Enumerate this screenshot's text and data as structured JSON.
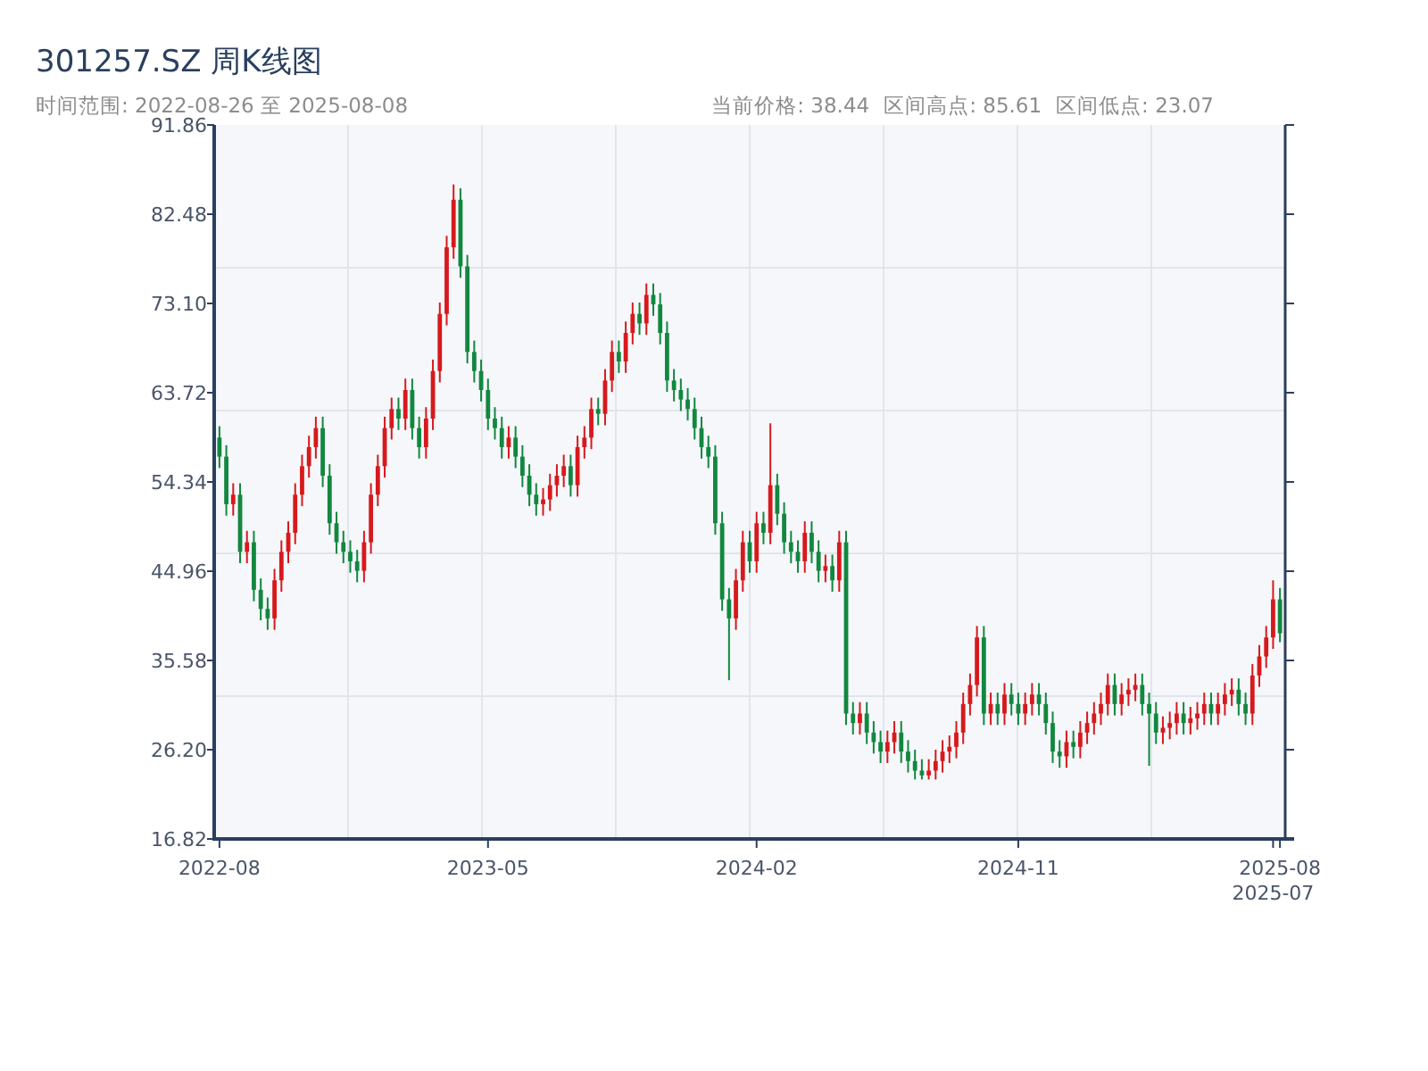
{
  "title": "301257.SZ 周K线图",
  "subtitle": "时间范围: 2022-08-26 至 2025-08-08",
  "stats": [
    "当前价格: 38.44",
    "区间高点: 85.61",
    "区间低点: 23.07"
  ],
  "chart": {
    "chart_data": {
      "type": "candlestick",
      "ylim": [
        16.82,
        91.86
      ],
      "yticks": [
        {
          "value": 91.86,
          "label": "91.86"
        },
        {
          "value": 82.48,
          "label": "82.48"
        },
        {
          "value": 73.1,
          "label": "73.10"
        },
        {
          "value": 63.72,
          "label": "63.72"
        },
        {
          "value": 54.34,
          "label": "54.34"
        },
        {
          "value": 44.96,
          "label": "44.96"
        },
        {
          "value": 35.58,
          "label": "35.58"
        },
        {
          "value": 26.2,
          "label": "26.20"
        },
        {
          "value": 16.82,
          "label": "16.82"
        }
      ],
      "categories": [
        "2022-08",
        null,
        null,
        null,
        null,
        null,
        null,
        null,
        null,
        null,
        null,
        null,
        null,
        null,
        null,
        null,
        null,
        null,
        null,
        null,
        null,
        null,
        null,
        null,
        null,
        null,
        null,
        null,
        null,
        null,
        null,
        null,
        null,
        null,
        null,
        null,
        null,
        null,
        null,
        "2023-05",
        null,
        null,
        null,
        null,
        null,
        null,
        null,
        null,
        null,
        null,
        null,
        null,
        null,
        null,
        null,
        null,
        null,
        null,
        null,
        null,
        null,
        null,
        null,
        null,
        null,
        null,
        null,
        null,
        null,
        null,
        null,
        null,
        null,
        null,
        null,
        null,
        null,
        null,
        "2024-02",
        null,
        null,
        null,
        null,
        null,
        null,
        null,
        null,
        null,
        null,
        null,
        null,
        null,
        null,
        null,
        null,
        null,
        null,
        null,
        null,
        null,
        null,
        null,
        null,
        null,
        null,
        null,
        null,
        null,
        null,
        null,
        null,
        null,
        null,
        null,
        null,
        null,
        "2024-11",
        null,
        null,
        null,
        null,
        null,
        null,
        null,
        null,
        null,
        null,
        null,
        null,
        null,
        null,
        null,
        null,
        null,
        null,
        null,
        null,
        null,
        null,
        null,
        null,
        null,
        null,
        null,
        null,
        null,
        null,
        null,
        null,
        null,
        null,
        null,
        null,
        "2025-07",
        "2025-08"
      ],
      "ohlc": [
        [
          59,
          60.2,
          55.8,
          57
        ],
        [
          57,
          58.2,
          50.8,
          52
        ],
        [
          52,
          54.2,
          50.8,
          53
        ],
        [
          53,
          54.2,
          45.8,
          47
        ],
        [
          47,
          49.2,
          45.8,
          48
        ],
        [
          48,
          49.2,
          41.8,
          43
        ],
        [
          43,
          44.2,
          39.8,
          41
        ],
        [
          41,
          42.2,
          38.8,
          40
        ],
        [
          40,
          45.2,
          38.8,
          44
        ],
        [
          44,
          48.2,
          42.8,
          47
        ],
        [
          47,
          50.2,
          45.8,
          49
        ],
        [
          49,
          54.2,
          47.8,
          53
        ],
        [
          53,
          57.2,
          51.8,
          56
        ],
        [
          56,
          59.2,
          54.8,
          58
        ],
        [
          58,
          61.2,
          56.8,
          60
        ],
        [
          60,
          61.2,
          53.8,
          55
        ],
        [
          55,
          56.2,
          48.8,
          50
        ],
        [
          50,
          51.2,
          46.8,
          48
        ],
        [
          48,
          49.2,
          45.8,
          47
        ],
        [
          47,
          48.2,
          44.8,
          46
        ],
        [
          46,
          47.2,
          43.8,
          45
        ],
        [
          45,
          49.2,
          43.8,
          48
        ],
        [
          48,
          54.2,
          46.8,
          53
        ],
        [
          53,
          57.2,
          51.8,
          56
        ],
        [
          56,
          61.2,
          54.8,
          60
        ],
        [
          60,
          63.2,
          58.8,
          62
        ],
        [
          62,
          63.2,
          59.8,
          61
        ],
        [
          61,
          65.2,
          59.8,
          64
        ],
        [
          64,
          65.2,
          58.8,
          60
        ],
        [
          60,
          61.2,
          56.8,
          58
        ],
        [
          58,
          62.2,
          56.8,
          61
        ],
        [
          61,
          67.2,
          59.8,
          66
        ],
        [
          66,
          73.2,
          64.8,
          72
        ],
        [
          72,
          80.2,
          70.8,
          79
        ],
        [
          79,
          85.61,
          77.8,
          84
        ],
        [
          84,
          85.2,
          75.8,
          77
        ],
        [
          77,
          78.2,
          66.8,
          68
        ],
        [
          68,
          69.2,
          64.8,
          66
        ],
        [
          66,
          67.2,
          62.8,
          64
        ],
        [
          64,
          65.2,
          59.8,
          61
        ],
        [
          61,
          62.2,
          58.8,
          60
        ],
        [
          60,
          61.2,
          56.8,
          58
        ],
        [
          58,
          60.2,
          56.8,
          59
        ],
        [
          59,
          60.2,
          55.8,
          57
        ],
        [
          57,
          58.2,
          53.8,
          55
        ],
        [
          55,
          56.2,
          51.8,
          53
        ],
        [
          53,
          54.2,
          50.8,
          52
        ],
        [
          52,
          53.7,
          50.8,
          52.5
        ],
        [
          52.5,
          55.2,
          51.3,
          54
        ],
        [
          54,
          56.2,
          52.8,
          55
        ],
        [
          55,
          57.2,
          53.8,
          56
        ],
        [
          56,
          57.2,
          52.8,
          54
        ],
        [
          54,
          59.2,
          52.8,
          58
        ],
        [
          58,
          60.2,
          56.8,
          59
        ],
        [
          59,
          63.2,
          57.8,
          62
        ],
        [
          62,
          63.2,
          60.3,
          61.5
        ],
        [
          61.5,
          66.2,
          60.3,
          65
        ],
        [
          65,
          69.2,
          63.8,
          68
        ],
        [
          68,
          69.2,
          65.8,
          67
        ],
        [
          67,
          71.2,
          65.8,
          70
        ],
        [
          70,
          73.2,
          68.8,
          72
        ],
        [
          72,
          73.2,
          69.8,
          71
        ],
        [
          71,
          75.2,
          69.8,
          74
        ],
        [
          74,
          75.2,
          71.8,
          73
        ],
        [
          73,
          74.2,
          68.8,
          70
        ],
        [
          70,
          71.2,
          63.8,
          65
        ],
        [
          65,
          66.2,
          62.8,
          64
        ],
        [
          64,
          65.2,
          61.8,
          63
        ],
        [
          63,
          64.2,
          60.8,
          62
        ],
        [
          62,
          63.2,
          58.8,
          60
        ],
        [
          60,
          61.2,
          56.8,
          58
        ],
        [
          58,
          59.2,
          55.8,
          57
        ],
        [
          57,
          58.2,
          48.8,
          50
        ],
        [
          50,
          51.2,
          40.8,
          42
        ],
        [
          42,
          43.2,
          33.5,
          40
        ],
        [
          40,
          45.2,
          38.8,
          44
        ],
        [
          44,
          49.2,
          42.8,
          48
        ],
        [
          48,
          49.2,
          44.8,
          46
        ],
        [
          46,
          51.2,
          44.8,
          50
        ],
        [
          50,
          51.2,
          47.8,
          49
        ],
        [
          49,
          60.5,
          47.8,
          54
        ],
        [
          54,
          55.2,
          49.8,
          51
        ],
        [
          51,
          52.2,
          46.8,
          48
        ],
        [
          48,
          49.2,
          45.8,
          47
        ],
        [
          47,
          48.2,
          44.8,
          46
        ],
        [
          46,
          50.2,
          44.8,
          49
        ],
        [
          49,
          50.2,
          45.8,
          47
        ],
        [
          47,
          48.2,
          43.8,
          45
        ],
        [
          45,
          46.7,
          43.8,
          45.5
        ],
        [
          45.5,
          46.7,
          42.8,
          44
        ],
        [
          44,
          49.2,
          42.8,
          48
        ],
        [
          48,
          49.2,
          28.8,
          30
        ],
        [
          30,
          31.2,
          27.8,
          29
        ],
        [
          29,
          31.2,
          27.8,
          30
        ],
        [
          30,
          31.2,
          26.8,
          28
        ],
        [
          28,
          29.2,
          25.8,
          27
        ],
        [
          27,
          28.2,
          24.8,
          26
        ],
        [
          26,
          28.2,
          24.8,
          27
        ],
        [
          27,
          29.2,
          25.8,
          28
        ],
        [
          28,
          29.2,
          24.8,
          26
        ],
        [
          26,
          27.2,
          23.8,
          25
        ],
        [
          25,
          26.2,
          23.07,
          24
        ],
        [
          24,
          25.2,
          23.07,
          23.5
        ],
        [
          23.5,
          25.2,
          23.07,
          24
        ],
        [
          24,
          26.2,
          23.07,
          25
        ],
        [
          25,
          27.2,
          23.8,
          26
        ],
        [
          26,
          27.7,
          24.8,
          26.5
        ],
        [
          26.5,
          29.2,
          25.3,
          28
        ],
        [
          28,
          32.2,
          26.8,
          31
        ],
        [
          31,
          34.2,
          29.8,
          33
        ],
        [
          33,
          39.2,
          31.8,
          38
        ],
        [
          38,
          39.2,
          28.8,
          30
        ],
        [
          30,
          32.2,
          28.8,
          31
        ],
        [
          31,
          32.2,
          28.8,
          30
        ],
        [
          30,
          33.2,
          28.8,
          32
        ],
        [
          32,
          33.2,
          29.8,
          31
        ],
        [
          31,
          32.2,
          28.8,
          30
        ],
        [
          30,
          32.2,
          28.8,
          31
        ],
        [
          31,
          33.2,
          29.8,
          32
        ],
        [
          32,
          33.2,
          29.8,
          31
        ],
        [
          31,
          32.2,
          27.8,
          29
        ],
        [
          29,
          30.2,
          24.8,
          26
        ],
        [
          26,
          27.2,
          24.3,
          25.5
        ],
        [
          25.5,
          28.2,
          24.3,
          27
        ],
        [
          27,
          28.2,
          25.3,
          26.5
        ],
        [
          26.5,
          29.2,
          25.3,
          28
        ],
        [
          28,
          30.2,
          26.8,
          29
        ],
        [
          29,
          31.2,
          27.8,
          30
        ],
        [
          30,
          32.2,
          28.8,
          31
        ],
        [
          31,
          34.2,
          29.8,
          33
        ],
        [
          33,
          34.2,
          29.8,
          31
        ],
        [
          31,
          33.2,
          29.8,
          32
        ],
        [
          32,
          33.7,
          30.8,
          32.5
        ],
        [
          32.5,
          34.2,
          31.3,
          33
        ],
        [
          33,
          34.2,
          29.8,
          31
        ],
        [
          31,
          32.2,
          24.5,
          30
        ],
        [
          30,
          31.2,
          26.8,
          28
        ],
        [
          28,
          29.7,
          26.8,
          28.5
        ],
        [
          28.5,
          30.2,
          27.3,
          29
        ],
        [
          29,
          31.2,
          27.8,
          30
        ],
        [
          30,
          31.2,
          27.8,
          29
        ],
        [
          29,
          30.7,
          27.8,
          29.5
        ],
        [
          29.5,
          31.2,
          28.3,
          30
        ],
        [
          30,
          32.2,
          28.8,
          31
        ],
        [
          31,
          32.2,
          28.8,
          30
        ],
        [
          30,
          32.2,
          28.8,
          31
        ],
        [
          31,
          33.2,
          29.8,
          32
        ],
        [
          32,
          33.7,
          30.8,
          32.5
        ],
        [
          32.5,
          33.7,
          29.8,
          31
        ],
        [
          31,
          32.2,
          28.8,
          30
        ],
        [
          30,
          35.2,
          28.8,
          34
        ],
        [
          34,
          37.2,
          32.8,
          36
        ],
        [
          36,
          39.2,
          34.8,
          38
        ],
        [
          38,
          44,
          36.8,
          42
        ],
        [
          42,
          43.2,
          37.5,
          38.44
        ]
      ]
    }
  }
}
